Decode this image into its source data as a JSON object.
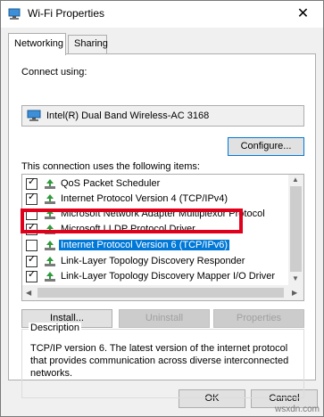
{
  "window": {
    "title": "Wi-Fi Properties",
    "close_glyph": "✕"
  },
  "tabs": [
    {
      "label": "Networking",
      "active": true
    },
    {
      "label": "Sharing",
      "active": false
    }
  ],
  "connect_using": {
    "label": "Connect using:",
    "adapter": "Intel(R) Dual Band Wireless-AC 3168",
    "adapter_icon": "network-adapter-icon",
    "configure_label": "Configure..."
  },
  "items_section": {
    "label": "This connection uses the following items:",
    "items": [
      {
        "label": "QoS Packet Scheduler",
        "checked": true,
        "icon": "service-icon"
      },
      {
        "label": "Internet Protocol Version 4 (TCP/IPv4)",
        "checked": true,
        "icon": "protocol-icon"
      },
      {
        "label": "Microsoft Network Adapter Multiplexor Protocol",
        "checked": false,
        "icon": "protocol-icon"
      },
      {
        "label": "Microsoft LLDP Protocol Driver",
        "checked": true,
        "icon": "protocol-icon"
      },
      {
        "label": "Internet Protocol Version 6 (TCP/IPv6)",
        "checked": false,
        "icon": "protocol-icon",
        "selected": true
      },
      {
        "label": "Link-Layer Topology Discovery Responder",
        "checked": true,
        "icon": "protocol-icon"
      },
      {
        "label": "Link-Layer Topology Discovery Mapper I/O Driver",
        "checked": true,
        "icon": "protocol-icon"
      }
    ],
    "install_label": "Install...",
    "uninstall_label": "Uninstall",
    "properties_label": "Properties"
  },
  "description": {
    "title": "Description",
    "text": "TCP/IP version 6. The latest version of the internet protocol that provides communication across diverse interconnected networks."
  },
  "footer": {
    "ok_label": "OK",
    "cancel_label": "Cancel"
  },
  "watermark": "wsxdn.com",
  "colors": {
    "selection": "#0078d7",
    "highlight_box": "#e0001b",
    "dialog_bg": "#f0f0f0"
  }
}
